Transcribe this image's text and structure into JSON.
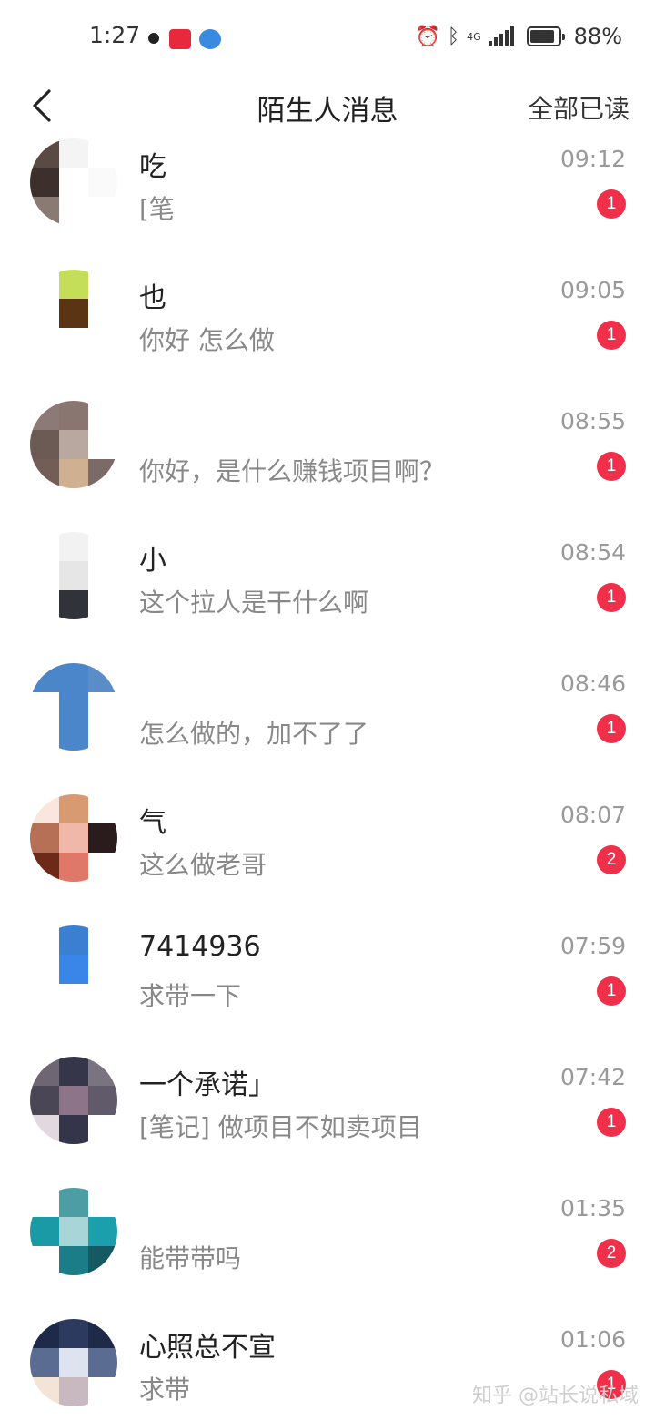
{
  "status_bar": {
    "time": "1:27",
    "battery_percent": "88%",
    "battery_level": 0.88,
    "network_label": "4G",
    "icons": [
      "eye-icon",
      "app-notification-icon",
      "browser-icon",
      "alarm-icon",
      "bluetooth-icon",
      "signal-icon",
      "battery-icon"
    ]
  },
  "header": {
    "back_icon": "chevron-left-icon",
    "title": "陌生人消息",
    "mark_all_read": "全部已读"
  },
  "messages": [
    {
      "name": "吃",
      "preview": "[笔",
      "time": "09:12",
      "badge": "1",
      "avatar_colors": [
        "#5a4a44",
        "#f4f4f4",
        "#ffffff",
        "#3d302c",
        "#ffffff",
        "#fafafa",
        "#8a7a74",
        "#ffffff",
        "#ffffff"
      ]
    },
    {
      "name": "也",
      "preview": "你好 怎么做",
      "time": "09:05",
      "badge": "1",
      "avatar_colors": [
        "#ffffff",
        "#c5de5a",
        "#ffffff",
        "#ffffff",
        "#5b3414",
        "#ffffff",
        "#ffffff",
        "#ffffff",
        "#ffffff"
      ]
    },
    {
      "name": "",
      "preview": "你好，是什么赚钱项目啊？",
      "time": "08:55",
      "badge": "1",
      "avatar_colors": [
        "#8c7a76",
        "#8a7670",
        "#ffffff",
        "#6c5a55",
        "#b8a8a0",
        "#ffffff",
        "#735d57",
        "#cfb090",
        "#7a6a68"
      ]
    },
    {
      "name": "小",
      "preview": "这个拉人是干什么啊",
      "time": "08:54",
      "badge": "1",
      "avatar_colors": [
        "#ffffff",
        "#f2f2f2",
        "#ffffff",
        "#ffffff",
        "#e6e6e6",
        "#ffffff",
        "#ffffff",
        "#30343a",
        "#ffffff"
      ]
    },
    {
      "name": "",
      "preview": "怎么做的，加不了了",
      "time": "08:46",
      "badge": "1",
      "avatar_colors": [
        "#4b86c8",
        "#4a86c9",
        "#5a8cc8",
        "#ffffff",
        "#4a86c9",
        "#ffffff",
        "#ffffff",
        "#4a86c9",
        "#ffffff"
      ]
    },
    {
      "name": "气",
      "preview": "这么做老哥",
      "time": "08:07",
      "badge": "2",
      "avatar_colors": [
        "#fbe6de",
        "#d89a70",
        "#ffffff",
        "#b57055",
        "#f0b8a8",
        "#2a1c1c",
        "#6e2a18",
        "#e0786a",
        "#ffffff"
      ]
    },
    {
      "name": "7414936",
      "preview": "求带一下",
      "time": "07:59",
      "badge": "1",
      "avatar_colors": [
        "#ffffff",
        "#3a7fd0",
        "#ffffff",
        "#ffffff",
        "#3a85e8",
        "#ffffff",
        "#ffffff",
        "#ffffff",
        "#ffffff"
      ]
    },
    {
      "name": "一个承诺」",
      "preview": "[笔记] 做项目不如卖项目",
      "time": "07:42",
      "badge": "1",
      "avatar_colors": [
        "#6e6672",
        "#35364a",
        "#7a7480",
        "#4a4656",
        "#8e7488",
        "#605a6a",
        "#e2d8e0",
        "#34344a",
        "#ffffff"
      ]
    },
    {
      "name": "",
      "preview": "能带带吗",
      "time": "01:35",
      "badge": "2",
      "avatar_colors": [
        "#ffffff",
        "#4d9ea4",
        "#ffffff",
        "#1a9aa4",
        "#a8d6d8",
        "#1aa0ac",
        "#ffffff",
        "#1a7d88",
        "#155a62"
      ]
    },
    {
      "name": "心照总不宣",
      "preview": "求带",
      "time": "01:06",
      "badge": "1",
      "avatar_colors": [
        "#1e2a48",
        "#2b3a5e",
        "#1e2a48",
        "#5a6c92",
        "#dde4f0",
        "#5a6c92",
        "#f4e4d8",
        "#c8b8c0",
        "#ffffff"
      ]
    }
  ],
  "watermark": "知乎 @站长说私域"
}
